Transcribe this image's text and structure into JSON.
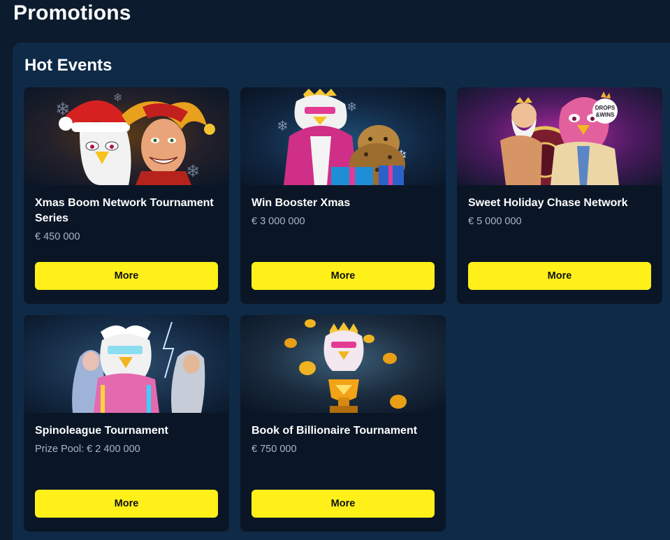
{
  "page": {
    "title": "Promotions"
  },
  "section": {
    "title": "Hot Events"
  },
  "cards": [
    {
      "title": "Xmas Boom Network Tournament Series",
      "prize": "€ 450 000",
      "button": "More"
    },
    {
      "title": "Win Booster Xmas",
      "prize": "€ 3 000 000",
      "button": "More"
    },
    {
      "title": "Sweet Holiday Chase Network",
      "prize": "€ 5 000 000",
      "button": "More",
      "badge": "DROPS &WINS"
    },
    {
      "title": "Spinoleague Tournament",
      "prize": "Prize Pool: € 2 400 000",
      "button": "More"
    },
    {
      "title": "Book of Billionaire Tournament",
      "prize": "€ 750 000",
      "button": "More"
    }
  ],
  "colors": {
    "page_bg": "#0c1b2e",
    "section_bg": "#0f2a47",
    "card_bg": "#0a1626",
    "button_bg": "#fff01a",
    "prize_text": "#a9b6c6"
  }
}
